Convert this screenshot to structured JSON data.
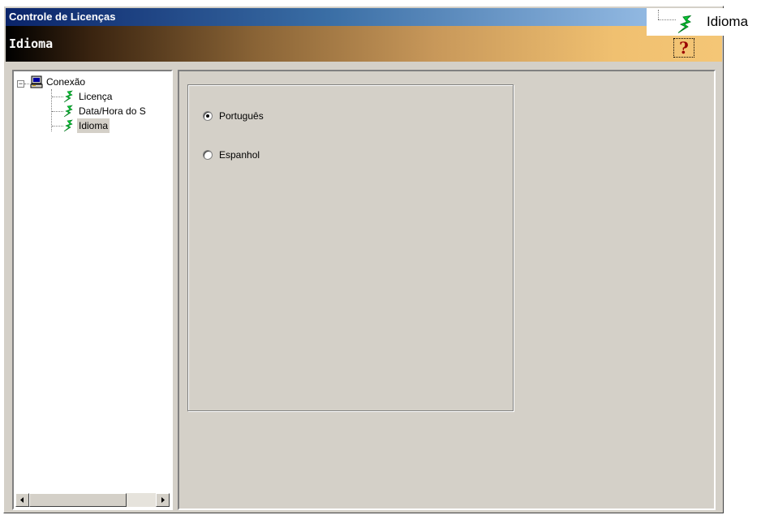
{
  "window": {
    "title": "Controle de Licenças"
  },
  "header": {
    "title": "Idioma",
    "help_glyph": "?"
  },
  "tree": {
    "root": {
      "label": "Conexão",
      "icon": "computer-icon",
      "expander": "−"
    },
    "children": [
      {
        "label": "Licença",
        "icon": "lightning-bolt-icon"
      },
      {
        "label": "Data/Hora do S",
        "icon": "lightning-bolt-icon"
      },
      {
        "label": "Idioma",
        "icon": "lightning-bolt-icon",
        "selected": true
      }
    ]
  },
  "language": {
    "options": [
      {
        "label": "Português",
        "checked": true
      },
      {
        "label": "Espanhol",
        "checked": false
      }
    ]
  },
  "drag_preview": {
    "label": "Idioma",
    "icon": "lightning-bolt-icon"
  },
  "colors": {
    "bolt": "#00cc33",
    "selected_bg": "#d4d0c8",
    "help": "#9a0000"
  }
}
